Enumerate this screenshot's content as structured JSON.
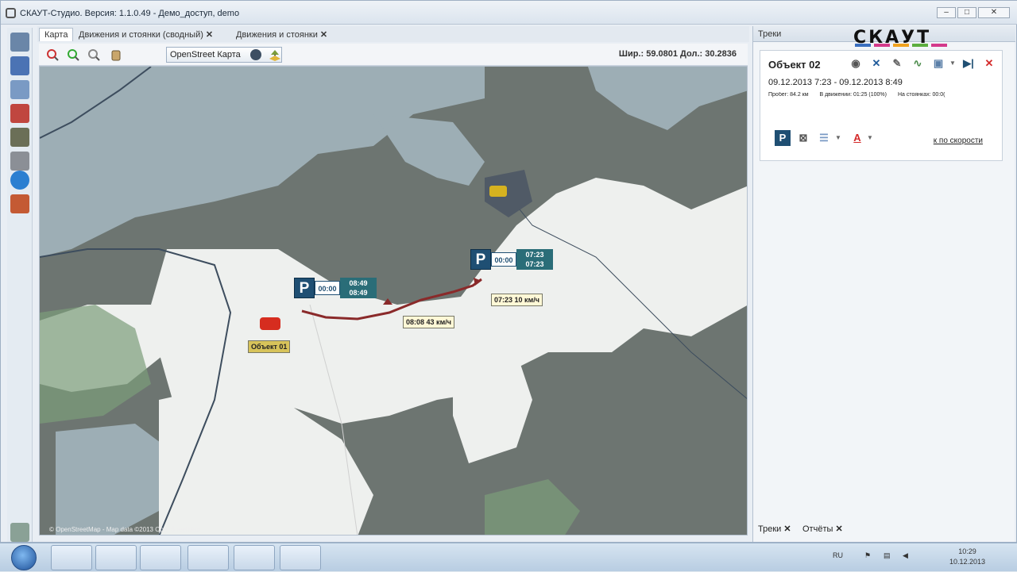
{
  "window": {
    "title": "СКАУТ-Студио. Версия: 1.1.0.49 - Демо_доступ, demo",
    "minimize_label": "–",
    "maximize_label": "□",
    "close_label": "✕"
  },
  "left_toolbar": {
    "items": [
      "list-icon",
      "report-icon",
      "document-icon",
      "track-icon",
      "objects-icon",
      "tools-icon",
      "info-icon",
      "user-exit-icon",
      "settings-icon"
    ]
  },
  "map_tabs": [
    {
      "label": "Карта",
      "closable": false,
      "active": true
    },
    {
      "label": "Движения и стоянки (сводный)",
      "closable": true,
      "active": false
    },
    {
      "label": "Движения и стоянки",
      "closable": true,
      "active": false
    }
  ],
  "map_toolbar": {
    "map_source": "OpenStreet Карта",
    "coords": "Шир.: 59.0801  Дол.: 30.2836"
  },
  "map": {
    "attribution": "© OpenStreetMap - Map data ©2013 OpenStreetMap",
    "speed_labels": [
      {
        "time": "08:08",
        "speed": "43 км/ч"
      },
      {
        "time": "07:23",
        "speed": "10 км/ч"
      }
    ],
    "parkings": [
      {
        "duration": "00:00",
        "start": "08:49",
        "end": "08:49"
      },
      {
        "duration": "00:00",
        "start": "07:23",
        "end": "07:23"
      }
    ],
    "object_label": "Объект 01",
    "track_color": "#8a2a2a"
  },
  "right_pane": {
    "header": "Треки",
    "logo_text": "СКАУТ",
    "object": {
      "name": "Объект 02",
      "dates": "09.12.2013 7:23 - 09.12.2013 8:49",
      "mileage": "Пробег: 84.2 км",
      "in_motion": "В движении: 01:25 (100%)",
      "at_parking": "На стоянках: 00:0("
    },
    "speed_link": "к по скорости",
    "bottom_tabs": [
      "Треки",
      "Отчёты"
    ]
  },
  "taskbar": {
    "apps": [
      "ie-icon",
      "explorer-icon",
      "media-player-icon",
      "chrome-icon",
      "chart-app-icon",
      "scout-app-icon"
    ],
    "time": "10:29",
    "date": "10.12.2013",
    "lang": "RU"
  }
}
